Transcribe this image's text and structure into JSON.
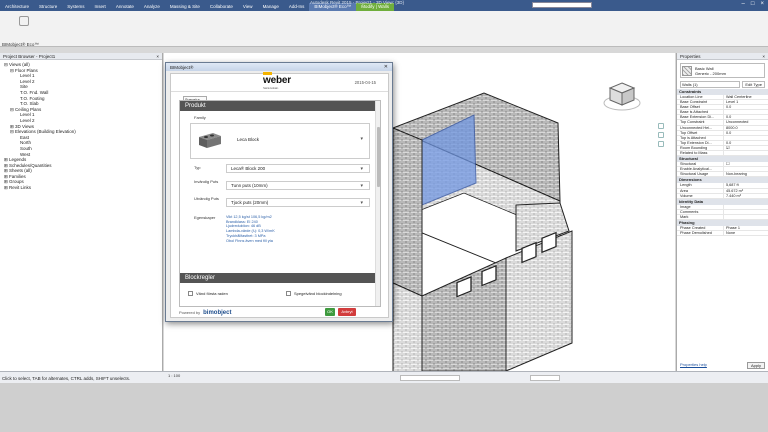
{
  "ribbon": {
    "tabs": [
      "Architecture",
      "Structure",
      "Systems",
      "Insert",
      "Annotate",
      "Analyze",
      "Massing & Site",
      "Collaborate",
      "View",
      "Manage",
      "Add-Ins",
      "BIMobject® Eco™",
      "Modify | Walls"
    ],
    "active_tab_index": 12,
    "window_title": "Autodesk Revit 2015 - Project1 - 3D View: {3D}"
  },
  "ribbon_panel": {
    "bim_label": "BIMobject® Eco™"
  },
  "project_browser": {
    "title": "Project Browser - Project1",
    "close": "×",
    "items": [
      {
        "level": 0,
        "label": "⊟ Views (all)"
      },
      {
        "level": 1,
        "label": "⊟ Floor Plans"
      },
      {
        "level": 2,
        "label": "Level 1"
      },
      {
        "level": 2,
        "label": "Level 2"
      },
      {
        "level": 2,
        "label": "Site"
      },
      {
        "level": 2,
        "label": "T.O. Fnd. Wall"
      },
      {
        "level": 2,
        "label": "T.O. Footing"
      },
      {
        "level": 2,
        "label": "T.O. Slab"
      },
      {
        "level": 1,
        "label": "⊟ Ceiling Plans"
      },
      {
        "level": 2,
        "label": "Level 1"
      },
      {
        "level": 2,
        "label": "Level 2"
      },
      {
        "level": 1,
        "label": "⊞ 3D Views"
      },
      {
        "level": 1,
        "label": "⊟ Elevations (Building Elevation)"
      },
      {
        "level": 2,
        "label": "East"
      },
      {
        "level": 2,
        "label": "North"
      },
      {
        "level": 2,
        "label": "South"
      },
      {
        "level": 2,
        "label": "West"
      },
      {
        "level": 0,
        "label": "⊞ Legends"
      },
      {
        "level": 0,
        "label": "⊞ Schedules/Quantities"
      },
      {
        "level": 0,
        "label": "⊞ Sheets (all)"
      },
      {
        "level": 0,
        "label": "⊞ Families"
      },
      {
        "level": 0,
        "label": "⊞ Groups"
      },
      {
        "level": 0,
        "label": "⊞ Revit Links"
      }
    ]
  },
  "dialog": {
    "title": "BIMobject®",
    "close": "✕",
    "brand": "weber",
    "brand_sub": "Saint-Gobain",
    "date": "2015-04-15",
    "language": "Svenska",
    "section_product": "Produkt",
    "family_label": "Family",
    "family_value": "Leca Block",
    "typ_label": "Typ",
    "typ_value": "Leca® Block 200",
    "inv_label": "Invändig Puts",
    "inv_value": "Tunn puts (10mm)",
    "utv_label": "Utvändig Puts",
    "utv_value": "Tjock puts (20mm)",
    "egen_label": "Egenskaper",
    "properties": [
      "Vikt 12,5 kg/st 106,5 kg/m2",
      "Brandklass: EI 240",
      "Ljudreduktion: 46 dB",
      "Lambda-värde (λ): 0,3 W/mK",
      "Tryckhållfasthet: 3 MPa",
      "Obol Finns även med fill yta"
    ],
    "section_blocks": "Blockregler",
    "check1": "Vänd första raden",
    "check2": "Spegelvänd blockindelning",
    "powered_by": "Powered by",
    "bim_brand": "bimobject",
    "ok": "OK",
    "cancel": "Avbryt"
  },
  "properties": {
    "title": "Properties",
    "close": "×",
    "type_name": "Basic Wall",
    "type_sub": "Generic - 200mm",
    "filter": "Walls (1)",
    "edit_type": "Edit Type",
    "groups": [
      {
        "name": "Constraints",
        "rows": [
          [
            "Location Line",
            "Wall Centerline"
          ],
          [
            "Base Constraint",
            "Level 1"
          ],
          [
            "Base Offset",
            "0.0"
          ],
          [
            "Base is Attached",
            ""
          ],
          [
            "Base Extension Di...",
            "0.0"
          ],
          [
            "Top Constraint",
            "Unconnected"
          ],
          [
            "Unconnected Hei...",
            "8000.0"
          ],
          [
            "Top Offset",
            "0.0"
          ],
          [
            "Top is Attached",
            ""
          ],
          [
            "Top Extension Di...",
            "0.0"
          ],
          [
            "Room Bounding",
            "☑"
          ],
          [
            "Related to Mass",
            ""
          ]
        ]
      },
      {
        "name": "Structural",
        "rows": [
          [
            "Structural",
            "☐"
          ],
          [
            "Enable Analytical...",
            ""
          ],
          [
            "Structural Usage",
            "Non-bearing"
          ]
        ]
      },
      {
        "name": "Dimensions",
        "rows": [
          [
            "Length",
            "5,687 ft"
          ],
          [
            "Area",
            "45.672 m²"
          ],
          [
            "Volume",
            "7.440 m³"
          ]
        ]
      },
      {
        "name": "Identity Data",
        "rows": [
          [
            "Image",
            ""
          ],
          [
            "Comments",
            ""
          ],
          [
            "Mark",
            ""
          ]
        ]
      },
      {
        "name": "Phasing",
        "rows": [
          [
            "Phase Created",
            "Phase 1"
          ],
          [
            "Phase Demolished",
            "None"
          ]
        ]
      }
    ],
    "help_link": "Properties help",
    "apply": "Apply"
  },
  "status_bar": {
    "text": "Click to select, TAB for alternates, CTRL adds, SHIFT unselects.",
    "scale": "1 : 100"
  }
}
